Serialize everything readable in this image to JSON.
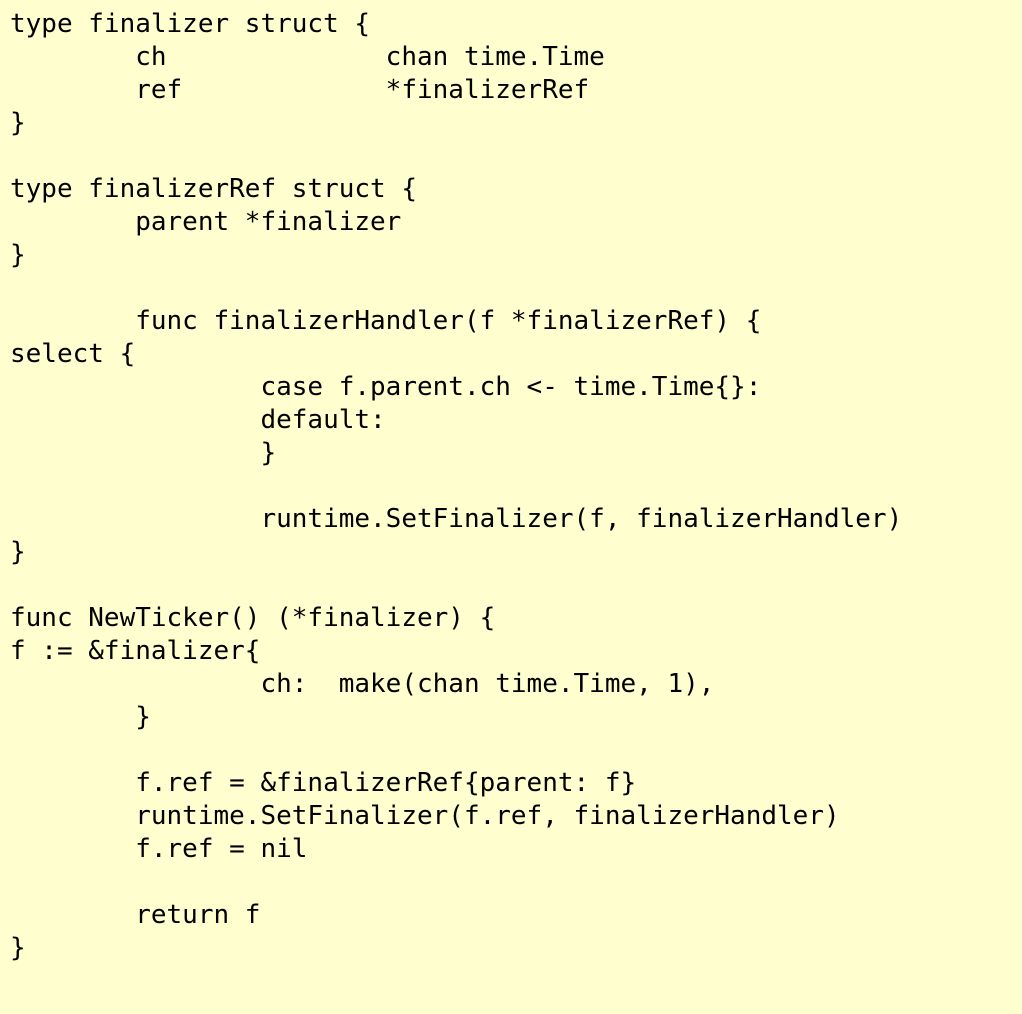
{
  "code": {
    "lines": [
      "type finalizer struct {",
      "        ch              chan time.Time",
      "        ref             *finalizerRef",
      "}",
      "",
      "type finalizerRef struct {",
      "        parent *finalizer",
      "}",
      "",
      "        func finalizerHandler(f *finalizerRef) {",
      "select {",
      "                case f.parent.ch <- time.Time{}:",
      "                default:",
      "                }",
      "",
      "                runtime.SetFinalizer(f, finalizerHandler)",
      "}",
      "",
      "func NewTicker() (*finalizer) {",
      "f := &finalizer{",
      "                ch:  make(chan time.Time, 1),",
      "        }",
      "",
      "        f.ref = &finalizerRef{parent: f}",
      "        runtime.SetFinalizer(f.ref, finalizerHandler)",
      "        f.ref = nil",
      "",
      "        return f",
      "}"
    ]
  }
}
